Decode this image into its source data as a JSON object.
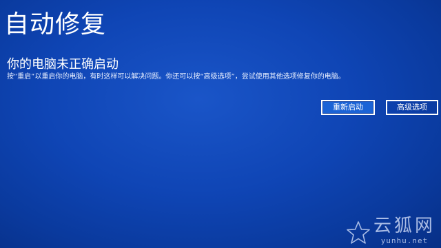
{
  "screen": {
    "title": "自动修复",
    "heading": "你的电脑未正确启动",
    "message": "按“重启”以重启你的电脑，有时这样可以解决问题。你还可以按“高级选项”，尝试使用其他选项修复你的电脑。"
  },
  "buttons": {
    "restart_label": "重新启动",
    "advanced_label": "高级选项"
  },
  "watermark": {
    "brand": "云狐网",
    "url": "yunhu.net",
    "icon": "star-icon"
  },
  "colors": {
    "background": "#0f45b5",
    "text": "#ffffff",
    "focused_button": "#1b63d6"
  }
}
